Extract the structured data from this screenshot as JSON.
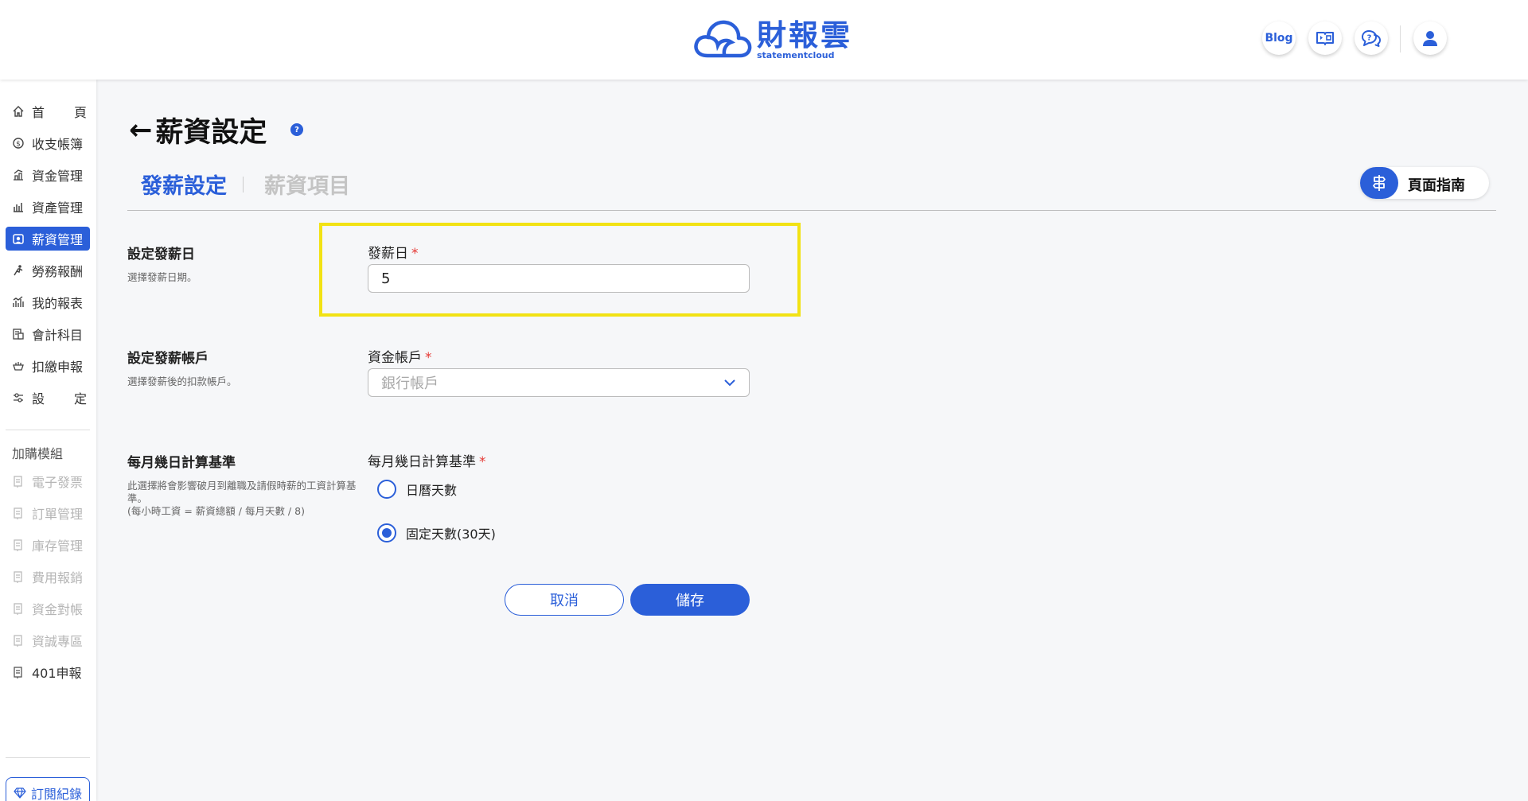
{
  "header": {
    "logo_cn": "財報雲",
    "logo_en": "statementcloud",
    "blog_label": "Blog",
    "icons": [
      "video-tutorial-icon",
      "support-chat-icon",
      "user-account-icon"
    ]
  },
  "sidebar": {
    "items": [
      {
        "label": "首　　頁",
        "icon": "home-icon"
      },
      {
        "label": "收支帳簿",
        "icon": "money-icon"
      },
      {
        "label": "資金管理",
        "icon": "fund-icon"
      },
      {
        "label": "資產管理",
        "icon": "assets-icon"
      },
      {
        "label": "薪資管理",
        "icon": "payroll-icon",
        "active": true
      },
      {
        "label": "勞務報酬",
        "icon": "labor-icon"
      },
      {
        "label": "我的報表",
        "icon": "chart-icon"
      },
      {
        "label": "會計科目",
        "icon": "accounts-icon"
      },
      {
        "label": "扣繳申報",
        "icon": "tax-icon"
      },
      {
        "label": "設　　定",
        "icon": "settings-icon"
      }
    ],
    "addon_title": "加購模組",
    "addons": [
      {
        "label": "電子發票"
      },
      {
        "label": "訂單管理"
      },
      {
        "label": "庫存管理"
      },
      {
        "label": "費用報銷"
      },
      {
        "label": "資金對帳"
      },
      {
        "label": "資誠專區"
      },
      {
        "label": "401申報"
      }
    ],
    "subscription_label": "訂閱紀錄"
  },
  "page": {
    "back_arrow": "←",
    "title": "薪資設定",
    "help": "?",
    "tabs": [
      {
        "label": "發薪設定",
        "active": true
      },
      {
        "label": "薪資項目",
        "active": false
      }
    ],
    "guide_label": "頁面指南"
  },
  "sections": {
    "payday": {
      "title": "設定發薪日",
      "desc": "選擇發薪日期。",
      "field_label": "發薪日",
      "value": "5"
    },
    "account": {
      "title": "設定發薪帳戶",
      "desc": "選擇發薪後的扣款帳戶。",
      "field_label": "資金帳戶",
      "placeholder": "銀行帳戶"
    },
    "basis": {
      "title": "每月幾日計算基準",
      "desc_line1": "此選擇將會影響破月到離職及請假時薪的工資計算基準。",
      "desc_line2": "(每小時工資 = 薪資總額 / 每月天數 / 8)",
      "field_label": "每月幾日計算基準",
      "options": [
        {
          "label": "日曆天數",
          "checked": false
        },
        {
          "label": "固定天數(30天)",
          "checked": true
        }
      ]
    }
  },
  "actions": {
    "cancel": "取消",
    "save": "儲存"
  },
  "colors": {
    "primary": "#2b5fd9",
    "highlight": "#f2e214",
    "required": "#e53935"
  }
}
